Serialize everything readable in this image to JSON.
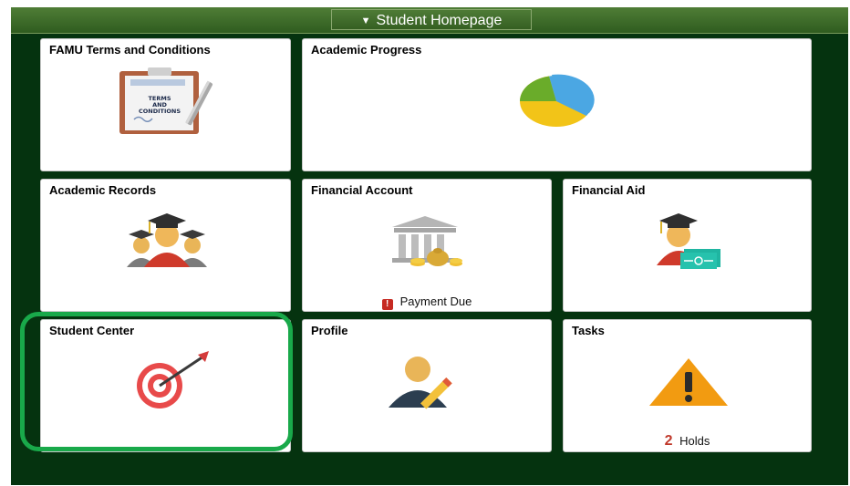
{
  "header": {
    "title": "Student Homepage"
  },
  "tiles": {
    "terms": {
      "label": "FAMU Terms and Conditions",
      "doc_text": [
        "TERMS",
        "AND",
        "CONDITIONS"
      ]
    },
    "progress": {
      "label": "Academic Progress"
    },
    "records": {
      "label": "Academic Records"
    },
    "financial_account": {
      "label": "Financial Account",
      "status": "Payment Due"
    },
    "financial_aid": {
      "label": "Financial Aid"
    },
    "student_center": {
      "label": "Student Center"
    },
    "profile": {
      "label": "Profile"
    },
    "tasks": {
      "label": "Tasks",
      "count": "2",
      "count_label": "Holds"
    }
  }
}
